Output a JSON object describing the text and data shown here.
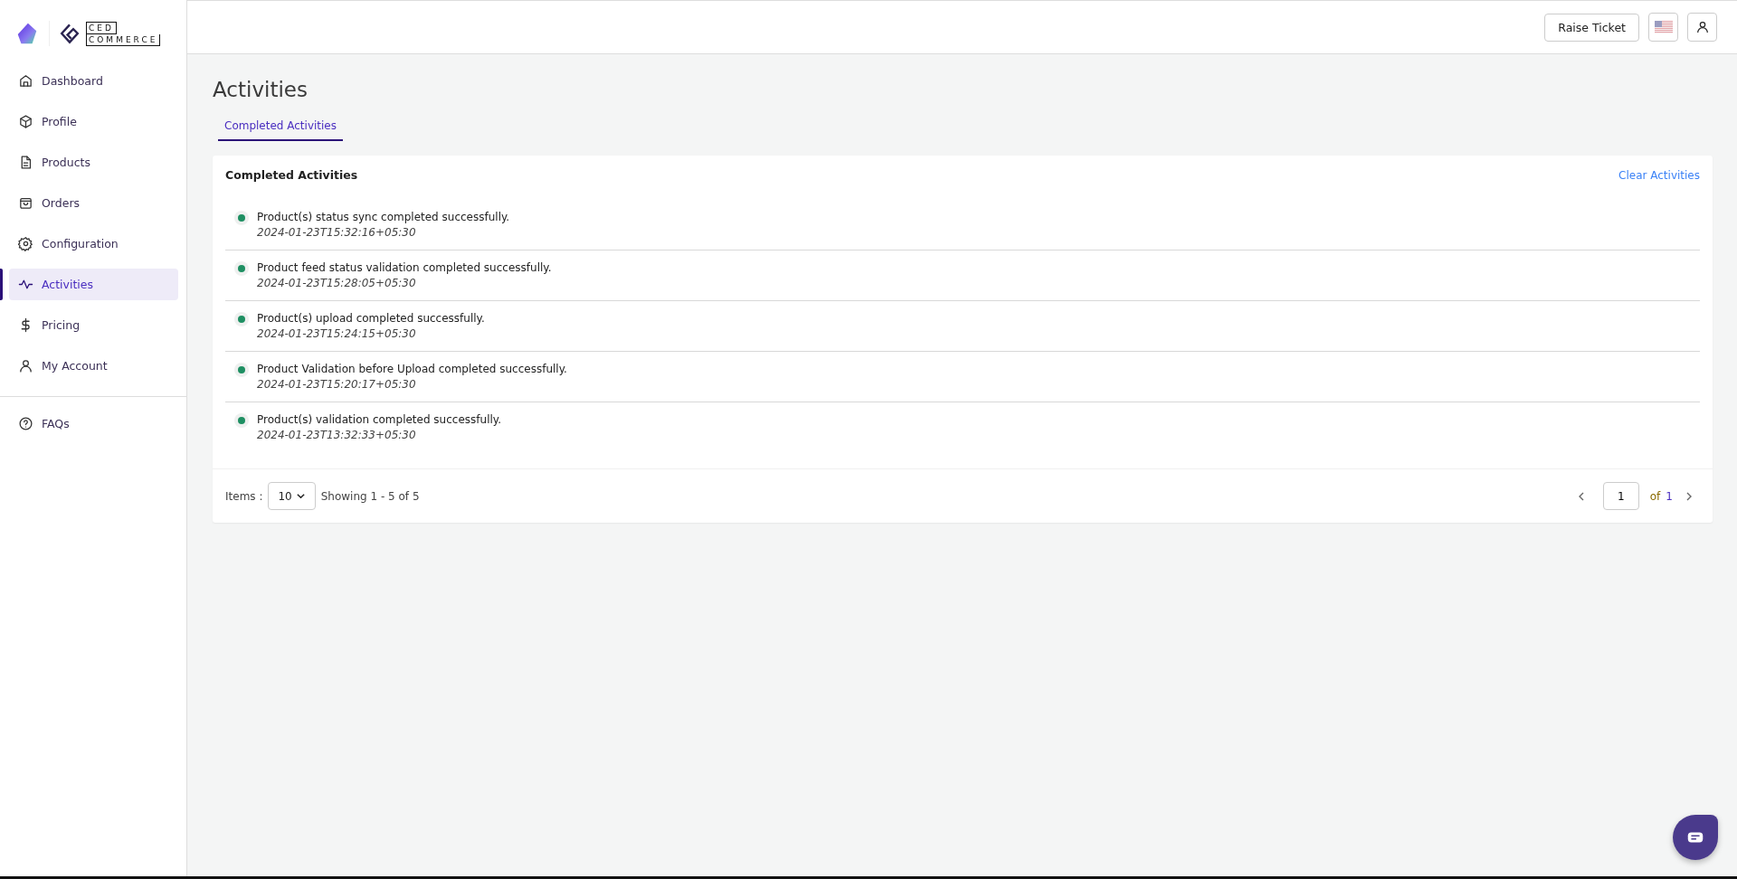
{
  "logo": {
    "line_1": "CED",
    "line_2": "COMMERCE"
  },
  "sidebar": {
    "items": [
      {
        "label": "Dashboard",
        "selected": false
      },
      {
        "label": "Profile",
        "selected": false
      },
      {
        "label": "Products",
        "selected": false
      },
      {
        "label": "Orders",
        "selected": false
      },
      {
        "label": "Configuration",
        "selected": false
      },
      {
        "label": "Activities",
        "selected": true
      },
      {
        "label": "Pricing",
        "selected": false
      },
      {
        "label": "My Account",
        "selected": false
      }
    ],
    "footer_items": [
      {
        "label": "FAQs",
        "selected": false
      }
    ]
  },
  "header": {
    "raise_ticket": "Raise Ticket"
  },
  "page": {
    "title": "Activities",
    "tabs": [
      {
        "label": "Completed Activities",
        "selected": true
      }
    ]
  },
  "card": {
    "title": "Completed Activities",
    "action": "Clear Activities",
    "activities": [
      {
        "message": "Product(s) status sync completed successfully.",
        "time": "2024-01-23T15:32:16+05:30",
        "color": "#1e8f62"
      },
      {
        "message": "Product feed status validation completed successfully.",
        "time": "2024-01-23T15:28:05+05:30",
        "color": "#1e8f62"
      },
      {
        "message": "Product(s) upload completed successfully.",
        "time": "2024-01-23T15:24:15+05:30",
        "color": "#1e8f62"
      },
      {
        "message": "Product Validation before Upload completed successfully.",
        "time": "2024-01-23T15:20:17+05:30",
        "color": "#1e8f62"
      },
      {
        "message": "Product(s) validation completed successfully.",
        "time": "2024-01-23T13:32:33+05:30",
        "color": "#1e8f62"
      }
    ]
  },
  "pagination": {
    "items_label": "Items :",
    "per_page": "10",
    "showing": "Showing 1 - 5 of 5",
    "page": "1",
    "of_label": "of",
    "total_pages": "1"
  }
}
